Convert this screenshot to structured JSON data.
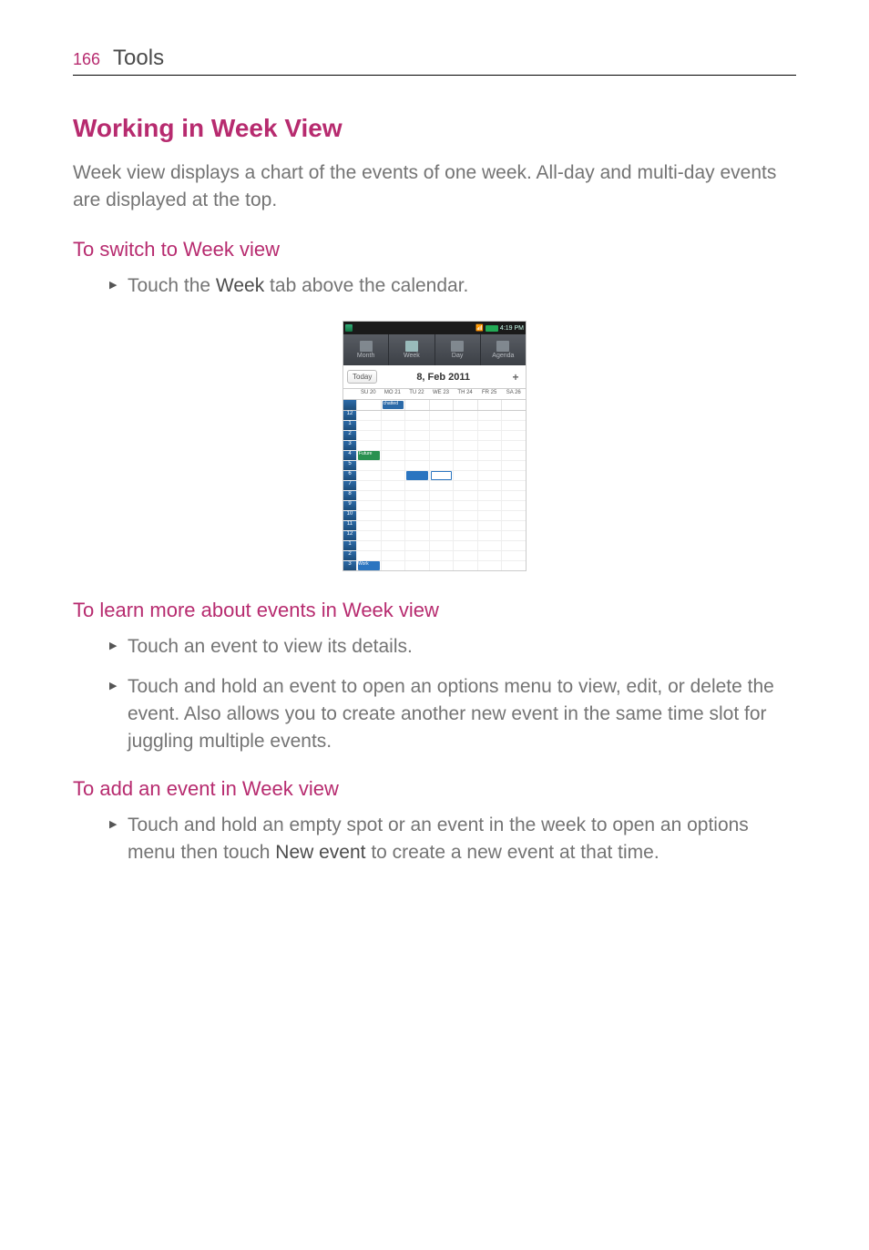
{
  "header": {
    "page_number": "166",
    "section_title": "Tools"
  },
  "h2_title": "Working in Week View",
  "intro_text": "Week view displays a chart of the events of one week. All-day and multi-day events are displayed at the top.",
  "section_switch": {
    "title": "To switch to Week view",
    "bullet_prefix": "Touch the ",
    "bullet_bold": "Week",
    "bullet_suffix": " tab above the calendar."
  },
  "section_learn": {
    "title": "To learn more about events in Week view",
    "bullets": [
      "Touch an event to view its details.",
      "Touch and hold an event to open an options menu to view, edit, or delete the event. Also allows you to create another new event in the same time slot for juggling multiple events."
    ]
  },
  "section_add": {
    "title": "To add an event in Week view",
    "bullet_prefix": "Touch and hold an empty spot or an event in the week to open an options menu then touch ",
    "bullet_bold": "New event",
    "bullet_suffix": " to create a new event at that time."
  },
  "screenshot": {
    "status_time": "4:19 PM",
    "tabs": [
      "Month",
      "Week",
      "Day",
      "Agenda"
    ],
    "tab_icons": [
      "31",
      "7",
      "1",
      "≡"
    ],
    "today": "Today",
    "date": "8, Feb 2011",
    "plus": "+",
    "day_headers": [
      "SU 20",
      "MO 21",
      "TU 22",
      "WE 23",
      "TH 24",
      "FR 25",
      "SA 26"
    ],
    "allday_label": "chatted",
    "hours": [
      "12",
      "1",
      "2",
      "3",
      "4",
      "5",
      "6",
      "7",
      "8",
      "9",
      "10",
      "11",
      "12",
      "1",
      "2",
      "3"
    ],
    "event_green": "Future",
    "event_bottom": "Work"
  }
}
